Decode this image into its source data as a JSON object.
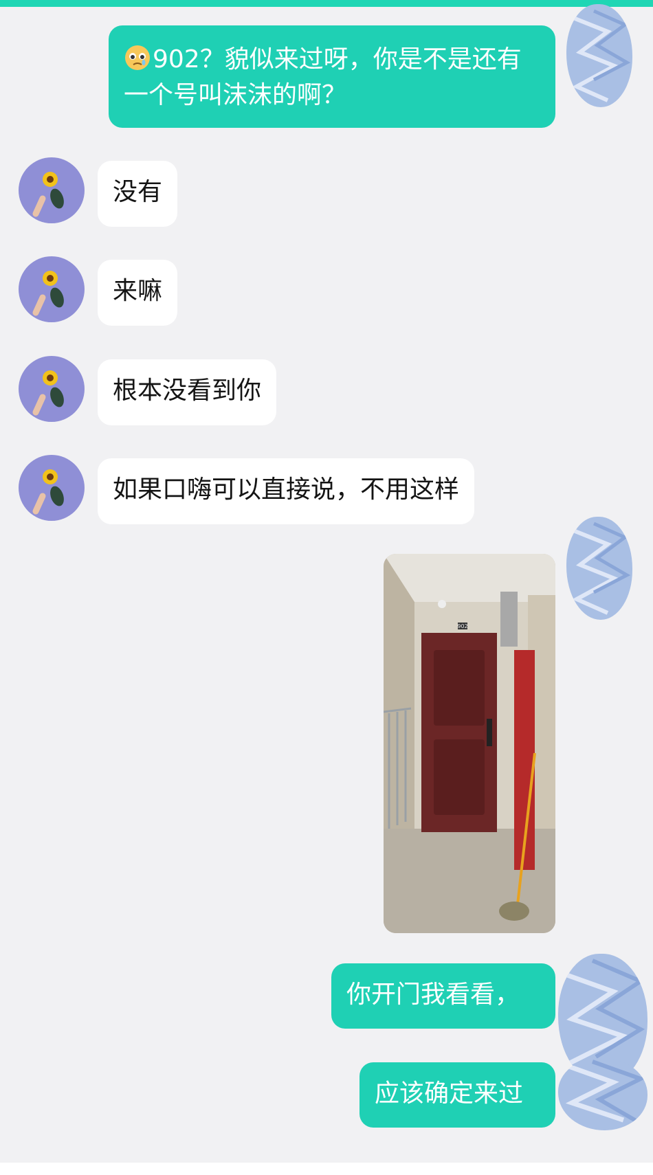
{
  "theme": {
    "accent": "#1fd0b4",
    "background": "#f1f1f3",
    "incoming_bubble": "#ffffff"
  },
  "messages": [
    {
      "from": "me",
      "emoji": "pleading-face",
      "text": "902？貌似来过呀，你是不是还有一个号叫沫沫的啊？"
    },
    {
      "from": "peer",
      "text": "没有"
    },
    {
      "from": "peer",
      "text": "来嘛"
    },
    {
      "from": "peer",
      "text": "根本没看到你"
    },
    {
      "from": "peer",
      "text": "如果口嗨可以直接说，不用这样"
    },
    {
      "from": "me",
      "type": "image",
      "image_label": "902"
    },
    {
      "from": "me",
      "text": "你开门我看看，"
    },
    {
      "from": "me",
      "text": "应该确定来过"
    }
  ],
  "avatars": {
    "peer": "sunflower-avatar-icon",
    "me": "blurred-avatar-icon"
  }
}
